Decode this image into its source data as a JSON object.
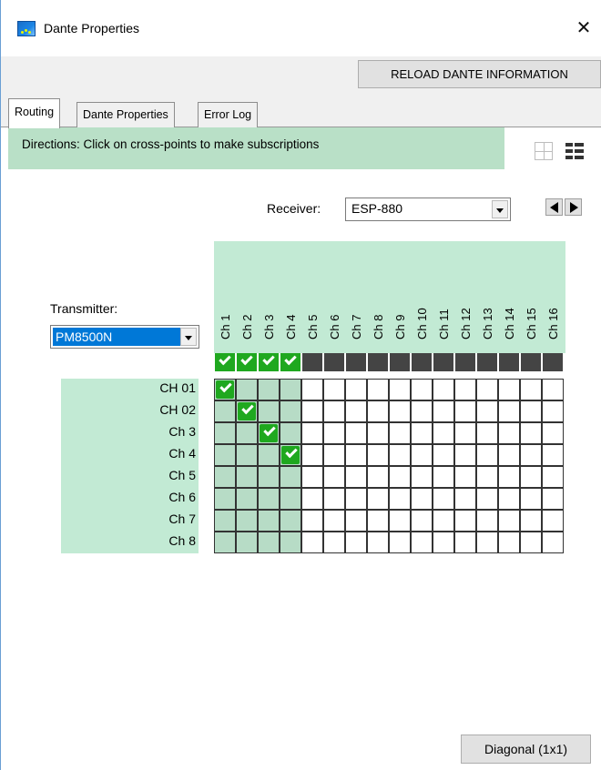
{
  "window": {
    "title": "Dante Properties",
    "close_glyph": "✕",
    "icon": "dante-app-icon"
  },
  "toolbar": {
    "reload_label": "RELOAD DANTE INFORMATION"
  },
  "tabs": [
    {
      "label": "Routing",
      "active": true
    },
    {
      "label": "Dante Properties",
      "active": false
    },
    {
      "label": "Error Log",
      "active": false
    }
  ],
  "routing": {
    "directions": "Directions: Click on cross-points to make subscriptions",
    "receiver_label": "Receiver:",
    "receiver_value": "ESP-880",
    "transmitter_label": "Transmitter:",
    "transmitter_value": "PM8500N",
    "columns": [
      "Ch 1",
      "Ch 2",
      "Ch 3",
      "Ch 4",
      "Ch 5",
      "Ch 6",
      "Ch 7",
      "Ch 8",
      "Ch 9",
      "Ch 10",
      "Ch 11",
      "Ch 12",
      "Ch 13",
      "Ch 14",
      "Ch 15",
      "Ch 16"
    ],
    "column_subscribed": [
      true,
      true,
      true,
      true,
      false,
      false,
      false,
      false,
      false,
      false,
      false,
      false,
      false,
      false,
      false,
      false
    ],
    "rows": [
      "CH 01",
      "CH 02",
      "Ch 3",
      "Ch 4",
      "Ch 5",
      "Ch 6",
      "Ch 7",
      "Ch 8"
    ],
    "subscriptions": [
      [
        0,
        0
      ],
      [
        1,
        1
      ],
      [
        2,
        2
      ],
      [
        3,
        3
      ]
    ],
    "diagonal_label": "Diagonal (1x1)"
  },
  "colors": {
    "accent_green": "#1fa81f",
    "panel_green": "#c2ead4",
    "selection_blue": "#0078d7"
  }
}
